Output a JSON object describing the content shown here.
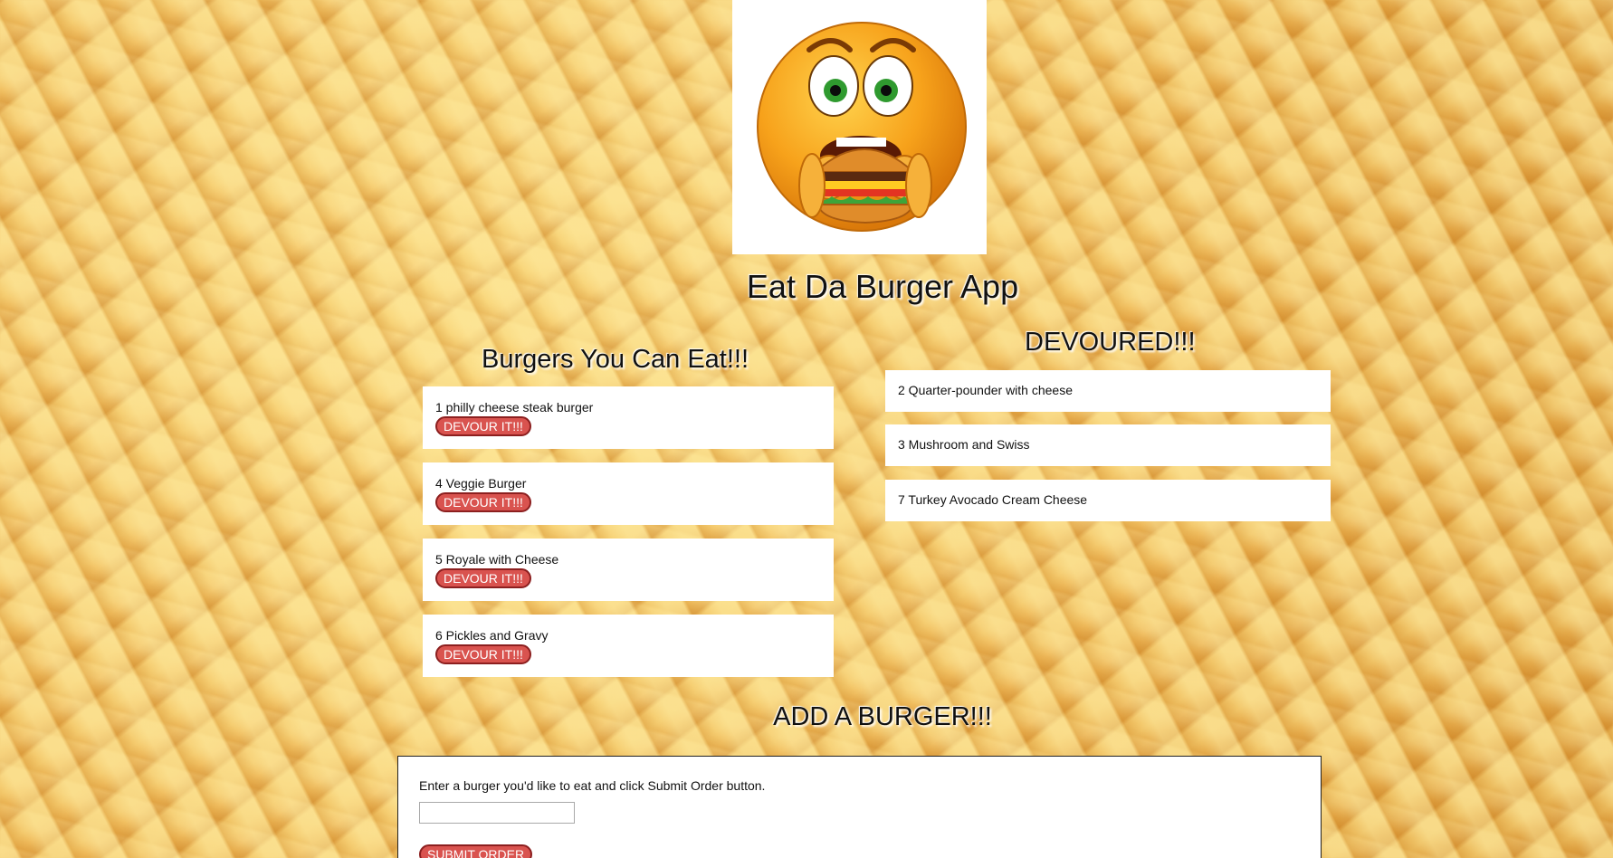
{
  "app": {
    "title": "Eat Da Burger App",
    "logo_icon": "emoji-eating-burger-icon"
  },
  "eat_column": {
    "title": "Burgers You Can Eat!!!",
    "button_label": "DEVOUR IT!!!",
    "items": [
      {
        "label": "1 philly cheese steak burger"
      },
      {
        "label": "4 Veggie Burger"
      },
      {
        "label": "5 Royale with Cheese"
      },
      {
        "label": "6 Pickles and Gravy"
      }
    ]
  },
  "devoured_column": {
    "title": "DEVOURED!!!",
    "items": [
      {
        "label": "2 Quarter-pounder with cheese"
      },
      {
        "label": "3 Mushroom and Swiss"
      },
      {
        "label": "7 Turkey Avocado Cream Cheese"
      }
    ]
  },
  "add_form": {
    "title": "ADD A BURGER!!!",
    "instructions": "Enter a burger you'd like to eat and click Submit Order button.",
    "input_value": "",
    "submit_label": "SUBMIT ORDER"
  },
  "colors": {
    "button_red": "#d9534f",
    "card_bg": "#ffffff",
    "background_fries": "#e7a640"
  }
}
